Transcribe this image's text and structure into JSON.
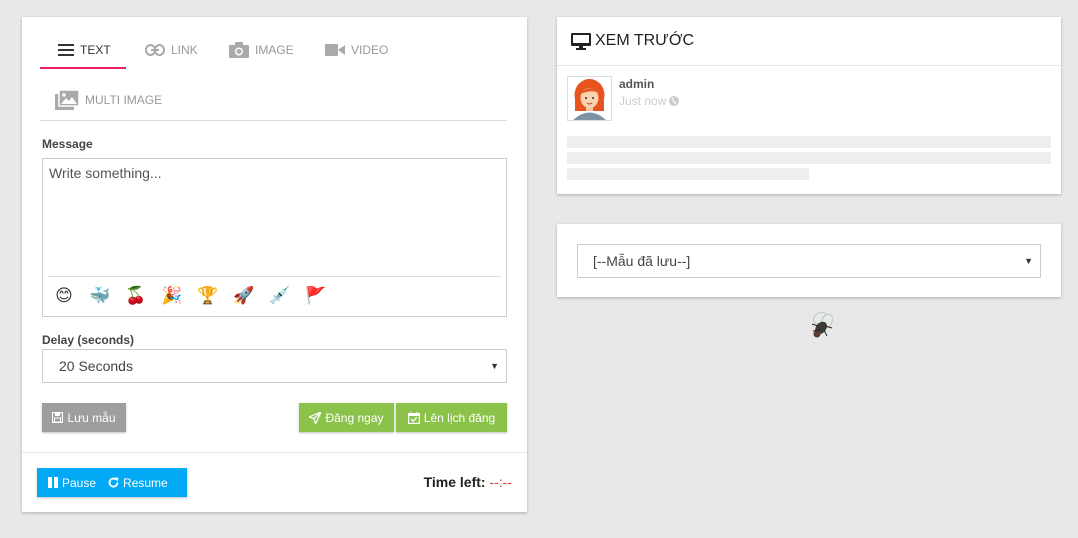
{
  "composer": {
    "tabs": [
      {
        "label": "TEXT",
        "icon": "lines-icon",
        "active": true
      },
      {
        "label": "LINK",
        "icon": "link-icon",
        "active": false
      },
      {
        "label": "IMAGE",
        "icon": "camera-icon",
        "active": false
      },
      {
        "label": "VIDEO",
        "icon": "video-icon",
        "active": false
      },
      {
        "label": "MULTI IMAGE",
        "icon": "images-icon",
        "active": false
      }
    ],
    "message_label": "Message",
    "message_placeholder": "Write something...",
    "emojis": [
      "😊",
      "🐳",
      "🍒",
      "🎉",
      "🏆",
      "🚀",
      "💉",
      "🚩"
    ],
    "delay_label": "Delay (seconds)",
    "delay_value": "20 Seconds",
    "save_template_label": "Lưu mẫu",
    "post_now_label": "Đăng ngay",
    "schedule_label": "Lên lịch đăng",
    "pause_label": "Pause",
    "resume_label": "Resume",
    "time_left_label": "Time left:",
    "time_left_value": "--:--"
  },
  "preview": {
    "title": "XEM TRƯỚC",
    "author": "admin",
    "time": "Just now"
  },
  "saved_templates": {
    "selected": "[--Mẫu đã lưu--]"
  },
  "colors": {
    "accent": "#e91e63",
    "green": "#8bc34a",
    "blue": "#03a9f4",
    "grey": "#9e9e9e",
    "red": "#e53935"
  }
}
